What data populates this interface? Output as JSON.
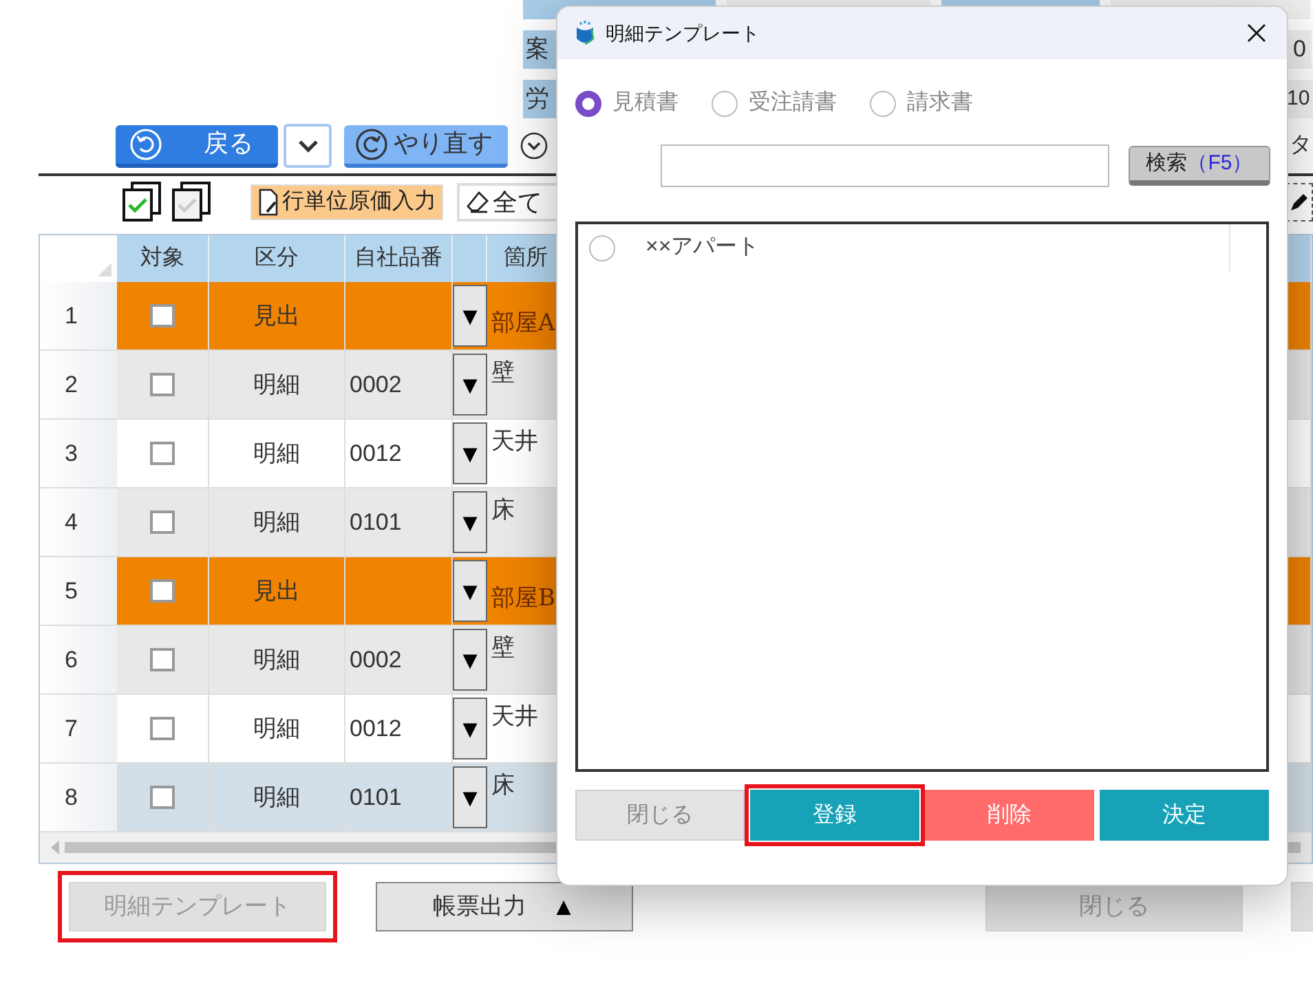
{
  "summary": {
    "rows": [
      {
        "cells": [
          {
            "kind": "label"
          },
          {
            "kind": "value"
          },
          {
            "kind": "label"
          },
          {
            "kind": "value"
          }
        ]
      },
      {
        "cells": [
          {
            "kind": "label",
            "text": "案"
          },
          {
            "kind": "value",
            "text": "0"
          }
        ]
      },
      {
        "cells": [
          {
            "kind": "label",
            "text": "労"
          },
          {
            "kind": "value",
            "text": "10"
          }
        ]
      }
    ]
  },
  "toolbar": {
    "back": "戻る",
    "redo": "やり直す",
    "trailing_text": "タ"
  },
  "subtoolbar": {
    "row_cost": "行単位原価入力",
    "clear_all": "全て"
  },
  "table": {
    "columns": [
      "対象",
      "区分",
      "自社品番",
      "箇所"
    ],
    "dropdown_glyph": "▼",
    "rows": [
      {
        "number": "1",
        "kind": "heading",
        "checked": false,
        "category": "見出",
        "place": "部屋A",
        "selected": false
      },
      {
        "number": "2",
        "kind": "detail",
        "checked": false,
        "category": "明細",
        "code": "0002",
        "place": "壁",
        "selected": false
      },
      {
        "number": "3",
        "kind": "detail",
        "checked": false,
        "category": "明細",
        "code": "0012",
        "place": "天井",
        "selected": false
      },
      {
        "number": "4",
        "kind": "detail",
        "checked": false,
        "category": "明細",
        "code": "0101",
        "place": "床",
        "selected": false
      },
      {
        "number": "5",
        "kind": "heading",
        "checked": false,
        "category": "見出",
        "place": "部屋B",
        "selected": false
      },
      {
        "number": "6",
        "kind": "detail",
        "checked": false,
        "category": "明細",
        "code": "0002",
        "place": "壁",
        "selected": false
      },
      {
        "number": "7",
        "kind": "detail",
        "checked": false,
        "category": "明細",
        "code": "0012",
        "place": "天井",
        "selected": false
      },
      {
        "number": "8",
        "kind": "detail",
        "checked": false,
        "category": "明細",
        "code": "0101",
        "place": "床",
        "selected": true
      }
    ]
  },
  "footer": [
    {
      "label": "明細テンプレート",
      "disabled": true,
      "highlighted": true
    },
    {
      "label": "帳票出力",
      "icon": "▲",
      "disabled": false,
      "highlighted": false
    },
    {
      "label": "閉じる",
      "disabled": true,
      "highlighted": false
    }
  ],
  "dialog": {
    "title": "明細テンプレート",
    "radios": [
      {
        "label": "見積書",
        "selected": true
      },
      {
        "label": "受注請書",
        "selected": false
      },
      {
        "label": "請求書",
        "selected": false
      }
    ],
    "search": {
      "button": "検索",
      "shortcut": "（F5）"
    },
    "list": [
      {
        "label": "××アパート",
        "selected": false
      }
    ],
    "buttons": [
      {
        "label": "閉じる",
        "kind": "neutral",
        "highlighted": false
      },
      {
        "label": "登録",
        "kind": "primary",
        "highlighted": true
      },
      {
        "label": "削除",
        "kind": "danger",
        "highlighted": false
      },
      {
        "label": "決定",
        "kind": "primary",
        "highlighted": false
      }
    ]
  }
}
